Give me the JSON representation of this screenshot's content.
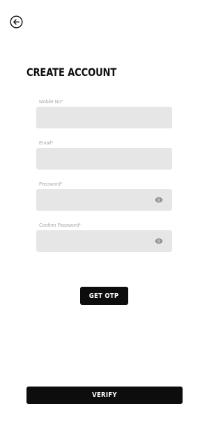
{
  "header": {
    "back_icon": "arrow-left-circle-icon",
    "title": "CREATE ACCOUNT"
  },
  "form": {
    "fields": [
      {
        "label": "Mobile No*",
        "value": "",
        "placeholder": ""
      },
      {
        "label": "Email*",
        "value": "",
        "placeholder": ""
      },
      {
        "label": "Password*",
        "value": "",
        "placeholder": "",
        "icon": "eye-icon"
      },
      {
        "label": "Confirm Password*",
        "value": "",
        "placeholder": "",
        "icon": "eye-icon"
      }
    ]
  },
  "actions": {
    "get_otp_label": "GET OTP",
    "verify_label": "VERIFY"
  },
  "colors": {
    "background": "#ffffff",
    "field_background": "#e6e6e6",
    "label_color": "#a9a9a9",
    "button_background": "#0d0d0d",
    "button_text": "#ffffff"
  }
}
